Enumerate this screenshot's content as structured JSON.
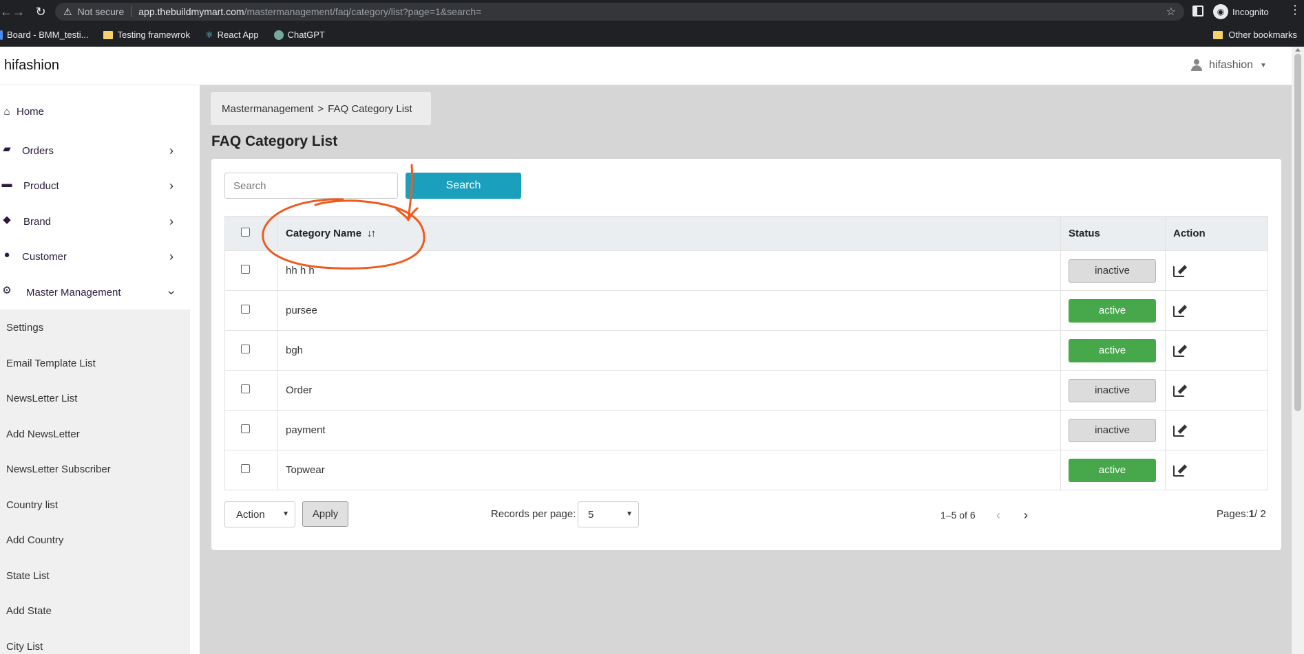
{
  "browser": {
    "security": "Not secure",
    "url_host": "app.thebuildmymart.com",
    "url_path": "/mastermanagement/faq/category/list?page=1&search=",
    "profile": "Incognito",
    "bookmarks": [
      "Board - BMM_testi...",
      "Testing framewrok",
      "React App",
      "ChatGPT"
    ],
    "other_bookmarks": "Other bookmarks"
  },
  "header": {
    "brand": "hifashion",
    "user": "hifashion"
  },
  "sidebar": {
    "items": [
      {
        "label": "Home",
        "icon": "home-icon"
      },
      {
        "label": "Orders",
        "icon": "bag-icon"
      },
      {
        "label": "Product",
        "icon": "box-icon"
      },
      {
        "label": "Brand",
        "icon": "tags-icon"
      },
      {
        "label": "Customer",
        "icon": "user-icon"
      },
      {
        "label": "Master Management",
        "icon": "user-gear-icon"
      }
    ],
    "submenu": [
      "Settings",
      "Email Template List",
      "NewsLetter List",
      "Add NewsLetter",
      "NewsLetter Subscriber",
      "Country list",
      "Add Country",
      "State List",
      "Add State",
      "City List"
    ]
  },
  "breadcrumb": {
    "parent": "Mastermanagement",
    "sep": ">",
    "current": "FAQ Category List"
  },
  "page_title": "FAQ Category List",
  "search": {
    "placeholder": "Search",
    "button": "Search"
  },
  "table": {
    "headers": {
      "name": "Category Name",
      "status": "Status",
      "action": "Action"
    },
    "rows": [
      {
        "name": "hh h h",
        "status": "inactive"
      },
      {
        "name": "pursee",
        "status": "active"
      },
      {
        "name": "bgh",
        "status": "active"
      },
      {
        "name": "Order",
        "status": "inactive"
      },
      {
        "name": "payment",
        "status": "inactive"
      },
      {
        "name": "Topwear",
        "status": "active"
      }
    ]
  },
  "footer": {
    "action_select": "Action",
    "apply": "Apply",
    "records_label": "Records per page:",
    "records_value": "5",
    "range": "1–5 of 6",
    "pages_label": "Pages:",
    "pages_current": "1",
    "pages_total": "/ 2"
  },
  "colors": {
    "search_button": "#1aa0bd",
    "active": "#46a84a",
    "annotation": "#f05a1e"
  }
}
